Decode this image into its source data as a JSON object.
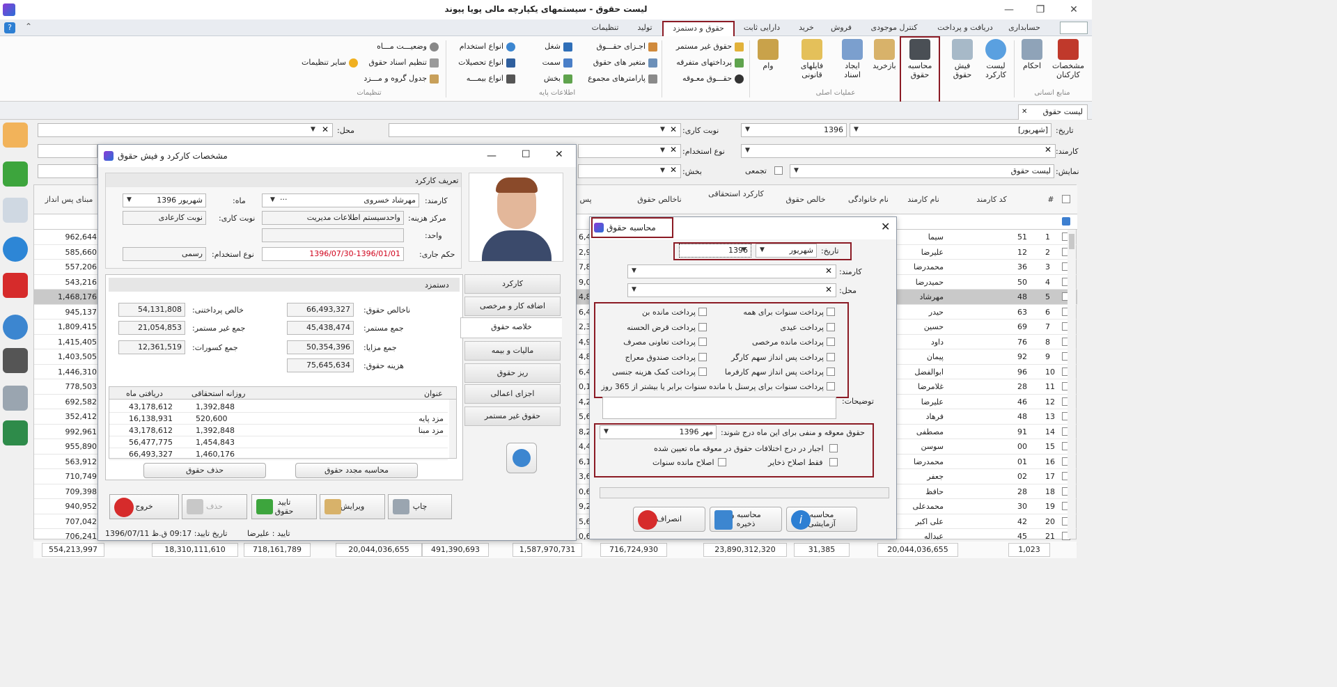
{
  "window": {
    "title": "لیست حقوق  - سیستمهای یکپارچه مالی پویا پیوند",
    "min": "—",
    "max": "❐",
    "close": "✕"
  },
  "menu": {
    "tabs": [
      "حسابداری",
      "دریافت و پرداخت",
      "کنترل موجودی",
      "فروش",
      "خرید",
      "دارایی ثابت",
      "حقوق و دستمزد",
      "تولید",
      "تنظیمات"
    ],
    "active": "حقوق و دستمزد"
  },
  "ribbon": {
    "hr_group": {
      "label": "منابع انسانی",
      "items": [
        "مشخصات کارکنان",
        "احکام"
      ]
    },
    "main_ops": {
      "label": "عملیات اصلی",
      "items": [
        "لیست کارکرد",
        "فیش حقوق",
        "محاسبه حقوق",
        "بازخرید",
        "ایجاد اسناد",
        "فایلهای قانونی",
        "وام"
      ]
    },
    "misc": [
      "حقوق غیر مستمر",
      "پرداختهای متفرقه",
      "حقـــوق معـوقه"
    ],
    "base_info": {
      "label": "اطلاعات پایه",
      "items": [
        "اجـزای حقـــوق",
        "متغیر های حقوق",
        "پارامترهای مجموع",
        "شغل",
        "سمت",
        "بخش",
        "انواع استخدام",
        "انواع تحصیلات",
        "انواع بیمـــه"
      ]
    },
    "settings": {
      "label": "تنظیمات",
      "items": [
        "وضعیـــت مـــاه",
        "تنظیم اسناد حقوق",
        "جدول گروه و مـــزد",
        "سایر تنظیمات"
      ]
    }
  },
  "doc_tab": {
    "label": "لیست حقوق",
    "close": "✕"
  },
  "filters": {
    "date_label": "تاریخ:",
    "month": "[شهریور]",
    "year": "1396",
    "shift_label": "نوبت کاری:",
    "place_label": "محل:",
    "employee_label": "کارمند:",
    "employment_label": "نوع استخدام:",
    "display_label": "نمایش:",
    "display_value": "لیست حقوق",
    "aggregate_label": "تجمعی",
    "section_label": "بخش:"
  },
  "grid": {
    "headers": [
      "#",
      "کد کارمند",
      "نام کارمند",
      "نام خانوادگی",
      "خالص حقوق",
      "کارکرد استحقاقی",
      "ناخالص حقوق",
      "پس",
      "مبنای پس انداز"
    ],
    "rows": [
      {
        "n": "1",
        "code": "51",
        "name": "سیما",
        "right": "962,644",
        "pp": "6,49"
      },
      {
        "n": "2",
        "code": "12",
        "name": "علیرضا",
        "right": "585,660",
        "pp": "2,94"
      },
      {
        "n": "3",
        "code": "36",
        "name": "محمدرضا",
        "right": "557,206",
        "pp": "7,80"
      },
      {
        "n": "4",
        "code": "50",
        "name": "حمیدرضا",
        "right": "543,216",
        "pp": "9,03"
      },
      {
        "n": "5",
        "code": "48",
        "name": "مهرشاد",
        "right": "1,468,176",
        "pp": "4,80"
      },
      {
        "n": "6",
        "code": "63",
        "name": "حیدر",
        "right": "945,137",
        "pp": "6,42"
      },
      {
        "n": "7",
        "code": "69",
        "name": "حسین",
        "right": "1,809,415",
        "pp": "2,38"
      },
      {
        "n": "8",
        "code": "76",
        "name": "داود",
        "right": "1,415,405",
        "pp": "4,95"
      },
      {
        "n": "9",
        "code": "92",
        "name": "پیمان",
        "right": "1,403,505",
        "pp": "4,87"
      },
      {
        "n": "10",
        "code": "96",
        "name": "ابوالفضل",
        "right": "1,446,310",
        "pp": "6,45"
      },
      {
        "n": "11",
        "code": "28",
        "name": "غلامرضا",
        "right": "778,503",
        "pp": "0,10"
      },
      {
        "n": "12",
        "code": "46",
        "name": "علیرضا",
        "right": "692,582",
        "pp": "4,25"
      },
      {
        "n": "13",
        "code": "48",
        "name": "فرهاد",
        "right": "352,412",
        "pp": "5,64"
      },
      {
        "n": "14",
        "code": "91",
        "name": "مصطفی",
        "right": "992,961",
        "pp": "8,26"
      },
      {
        "n": "15",
        "code": "00",
        "name": "سوسن",
        "right": "955,890",
        "pp": "4,48"
      },
      {
        "n": "16",
        "code": "01",
        "name": "محمدرضا",
        "right": "563,912",
        "pp": "6,13"
      },
      {
        "n": "17",
        "code": "02",
        "name": "جعفر",
        "right": "710,749",
        "pp": "3,67"
      },
      {
        "n": "18",
        "code": "28",
        "name": "حافظ",
        "right": "709,398",
        "pp": "0,63"
      },
      {
        "n": "19",
        "code": "30",
        "name": "محمدعلی",
        "right": "940,952",
        "pp": "9,22"
      },
      {
        "n": "20",
        "code": "42",
        "name": "علی اکبر",
        "right": "707,042",
        "pp": "5,65"
      },
      {
        "n": "21",
        "code": "45",
        "name": "عبداله",
        "right": "706,241",
        "pp": "0,63"
      }
    ],
    "totals": [
      "1,023",
      "20,044,036,655",
      "31,385",
      "23,890,312,320",
      "716,724,930",
      "1,587,970,731",
      "491,390,693",
      "20,044,036,655",
      "718,161,789",
      "18,310,111,610",
      "554,213,997"
    ]
  },
  "payslip": {
    "title": "مشخصات کارکرد و فیش حقوق",
    "section": "تعریف کارکرد",
    "employee_label": "کارمند:",
    "employee": "مهرشاد خسروی",
    "month_label": "ماه:",
    "month": "شهریور 1396",
    "cost_center_label": "مرکز هزینه:",
    "cost_center": "واحدسیستم اطلاعات مدیریت",
    "shift_label": "نوبت کاری:",
    "shift": "نوبت کارعادی",
    "unit_label": "واحد:",
    "decree_label": "حکم جاری:",
    "decree": "1396/07/30-1396/01/01",
    "employment_label": "نوع استخدام:",
    "employment": "رسمی",
    "wage_section": "دستمزد",
    "gross_label": "ناخالص حقوق:",
    "gross": "66,493,327",
    "net_label": "خالص پرداختنی:",
    "net": "54,131,808",
    "cont_label": "جمع مستمر:",
    "cont": "45,438,474",
    "noncont_label": "جمع غیر مستمر:",
    "noncont": "21,054,853",
    "benefit_label": "جمع مزایا:",
    "benefit": "50,354,396",
    "deduct_label": "جمع کسورات:",
    "deduct": "12,361,519",
    "cost_label": "هزینه حقوق:",
    "cost": "75,645,634",
    "table_headers": [
      "عنوان",
      "روزانه استحقاقی",
      "دریافتی ماه"
    ],
    "table_rows": [
      [
        "",
        "1,392,848",
        "43,178,612"
      ],
      [
        "مزد پایه",
        "520,600",
        "16,138,931"
      ],
      [
        "مزد مبنا",
        "1,392,848",
        "43,178,612"
      ],
      [
        "",
        "1,454,843",
        "56,477,775"
      ],
      [
        "",
        "1,460,176",
        "66,493,327"
      ]
    ],
    "tabs": [
      "کارکرد",
      "اضافه کار و مرخصی",
      "خلاصه حقوق",
      "مالیات و بیمه",
      "ریز حقوق",
      "اجزای اعمالی",
      "حقوق غیر مستمر"
    ],
    "active_tab": "خلاصه حقوق",
    "recalc": "محاسبه مجدد حقوق",
    "delete_salary": "حذف حقوق",
    "print": "چاپ",
    "edit": "ویرایش",
    "confirm": "تایید حقوق",
    "delete": "حذف",
    "exit": "خروج",
    "status_confirm": "تایید : علیرضا",
    "status_date": "تاریخ تایید: 09:17 ق.ظ 1396/07/11"
  },
  "calc": {
    "title": "محاسبه حقوق",
    "date_label": "تاریخ:",
    "month": "شهریور",
    "year": "1396",
    "employee_label": "کارمند:",
    "place_label": "محل:",
    "options_right": [
      "پرداخت سنوات برای همه",
      "پرداخت عیدی",
      "پرداخت مانده مرخصی",
      "پرداخت پس انداز سهم کارگر",
      "پرداخت پس انداز سهم کارفرما"
    ],
    "options_left": [
      "پرداخت مانده بن",
      "پرداخت قرض الحسنه",
      "پرداخت تعاونی مصرف",
      "پرداخت صندوق معراج",
      "پرداخت کمک هزینه جنسی"
    ],
    "option_wide": "پرداخت سنوات برای پرسنل با مانده سنوات برابر یا بیشتر از 365 روز",
    "notes_label": "توضیحات:",
    "arrears_label": "حقوق معوقه و منفی برای این ماه درج شوند:",
    "arrears_month": "مهر 1396",
    "force_label": "اجبار در درج اختلافات حقوق در معوقه ماه تعیین شده",
    "savings_label": "فقط اصلاح ذخایر",
    "seniority_label": "اصلاح مانده سنوات",
    "btn_test": "محاسبه آزمایشی",
    "btn_save": "محاسبه و ذخیره",
    "btn_cancel": "انصراف"
  },
  "colors": {
    "accent": "#8b1a24",
    "red_text": "#d0021b"
  }
}
